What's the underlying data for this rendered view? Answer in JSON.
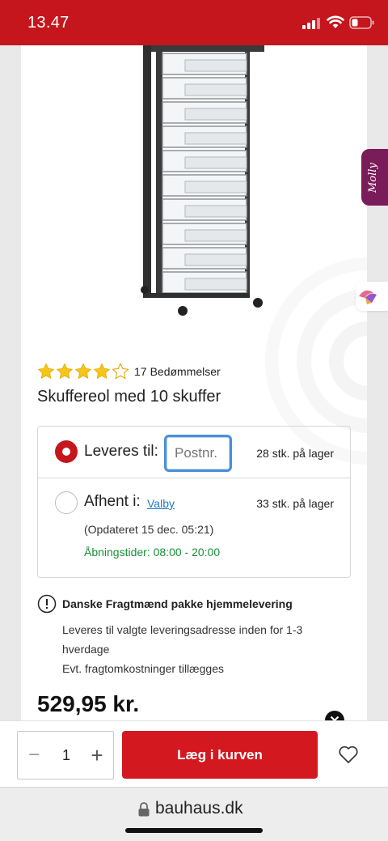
{
  "status": {
    "time": "13.47"
  },
  "colors": {
    "brand_red": "#c4161c",
    "button_red": "#d4181f",
    "star_yellow": "#f5c518",
    "stock_green": "#1a8f3a",
    "link_blue": "#1f7ac8"
  },
  "product": {
    "rating": 4,
    "rating_max": 5,
    "reviews_count": "17",
    "reviews_label": "Bedømmelser",
    "title": "Skuffereol med 10 skuffer"
  },
  "delivery": {
    "deliver_label": "Leveres til:",
    "postal_placeholder": "Postnr.",
    "deliver_stock": "28 stk. på lager",
    "pickup_label": "Afhent i:",
    "pickup_store": "Valby",
    "pickup_stock": "33 stk. på lager",
    "updated": "(Opdateret 15 dec. 05:21)",
    "hours": "Åbningstider: 08:00 - 20:00"
  },
  "shipping": {
    "title": "Danske Fragtmænd pakke hjemmelevering",
    "description": "Leveres til valgte leveringsadresse inden for 1-3 hverdage",
    "fee_note": "Evt. fragtomkostninger tillægges"
  },
  "price": "529,95 kr.",
  "side_tabs": {
    "molly_label": "Molly"
  },
  "cart": {
    "quantity": "1",
    "add_label": "Læg i kurven"
  },
  "browser": {
    "url": "bauhaus.dk"
  },
  "icons": [
    "signal-icon",
    "wifi-icon",
    "battery-icon",
    "star-icon",
    "info-icon",
    "close-icon",
    "minus-icon",
    "plus-icon",
    "heart-icon",
    "lock-icon"
  ]
}
